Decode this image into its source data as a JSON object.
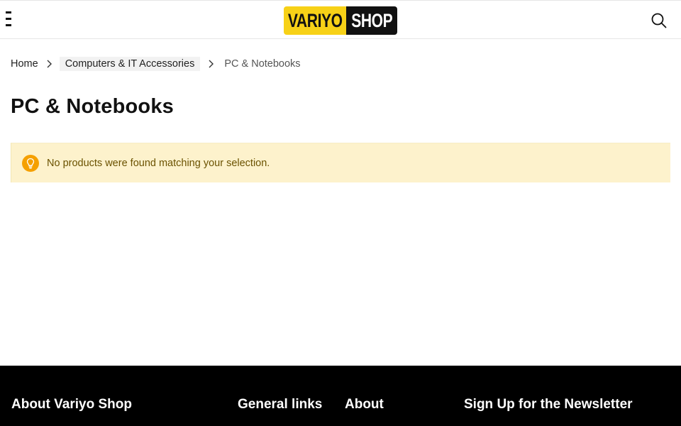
{
  "header": {
    "logo": {
      "left": "VARIYO",
      "right": "SHOP"
    },
    "icons": {
      "menu": "menu-icon",
      "search": "search-icon"
    }
  },
  "breadcrumb": {
    "home": "Home",
    "category": "Computers & IT Accessories",
    "current": "PC & Notebooks"
  },
  "page": {
    "title": "PC & Notebooks"
  },
  "notice": {
    "icon": "lightbulb-icon",
    "text": "No products were found matching your selection."
  },
  "footer": {
    "headings": {
      "about_shop": "About Variyo Shop",
      "general_links": "General links",
      "about": "About",
      "newsletter": "Sign Up for the Newsletter"
    }
  },
  "colors": {
    "brand_yellow": "#f7d117",
    "brand_black": "#111111",
    "notice_bg": "#fdf2cc",
    "notice_icon": "#f5a000",
    "notice_text": "#6b5200",
    "footer_bg": "#000000"
  }
}
